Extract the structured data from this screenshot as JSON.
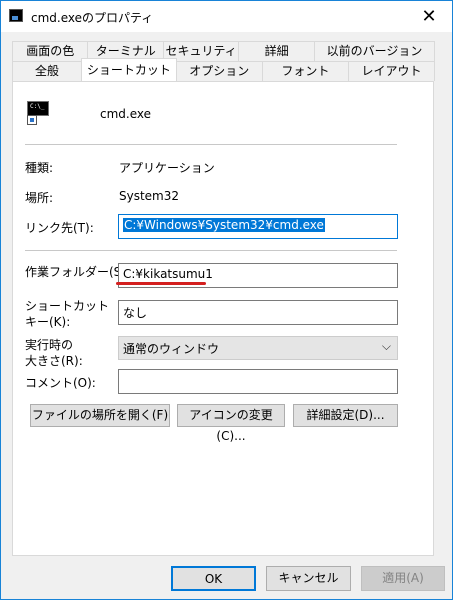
{
  "window": {
    "title": "cmd.exeのプロパティ",
    "close": "✕"
  },
  "tabs": {
    "back": [
      "画面の色",
      "ターミナル",
      "セキュリティ",
      "詳細",
      "以前のバージョン"
    ],
    "front": [
      "全般",
      "ショートカット",
      "オプション",
      "フォント",
      "レイアウト"
    ],
    "active": "ショートカット"
  },
  "shortcut": {
    "icon_text": "C:\\_",
    "file_name": "cmd.exe",
    "type_label": "種類:",
    "type_value": "アプリケーション",
    "location_label": "場所:",
    "location_value": "System32",
    "target_label": "リンク先(T):",
    "target_value": "C:¥Windows¥System32¥cmd.exe",
    "workdir_label": "作業フォルダー(S):",
    "workdir_value": "C:¥kikatsumu1",
    "hotkey_label_1": "ショートカット",
    "hotkey_label_2": "キー(K):",
    "hotkey_value": "なし",
    "run_label_1": "実行時の",
    "run_label_2": "大きさ(R):",
    "run_value": "通常のウィンドウ",
    "comment_label": "コメント(O):",
    "comment_value": "",
    "btn_open_location": "ファイルの場所を開く(F)",
    "btn_change_icon": "アイコンの変更(C)...",
    "btn_advanced": "詳細設定(D)..."
  },
  "footer": {
    "ok": "OK",
    "cancel": "キャンセル",
    "apply": "適用(A)"
  },
  "colors": {
    "accent": "#0078d7",
    "annotation": "#d4201f"
  }
}
